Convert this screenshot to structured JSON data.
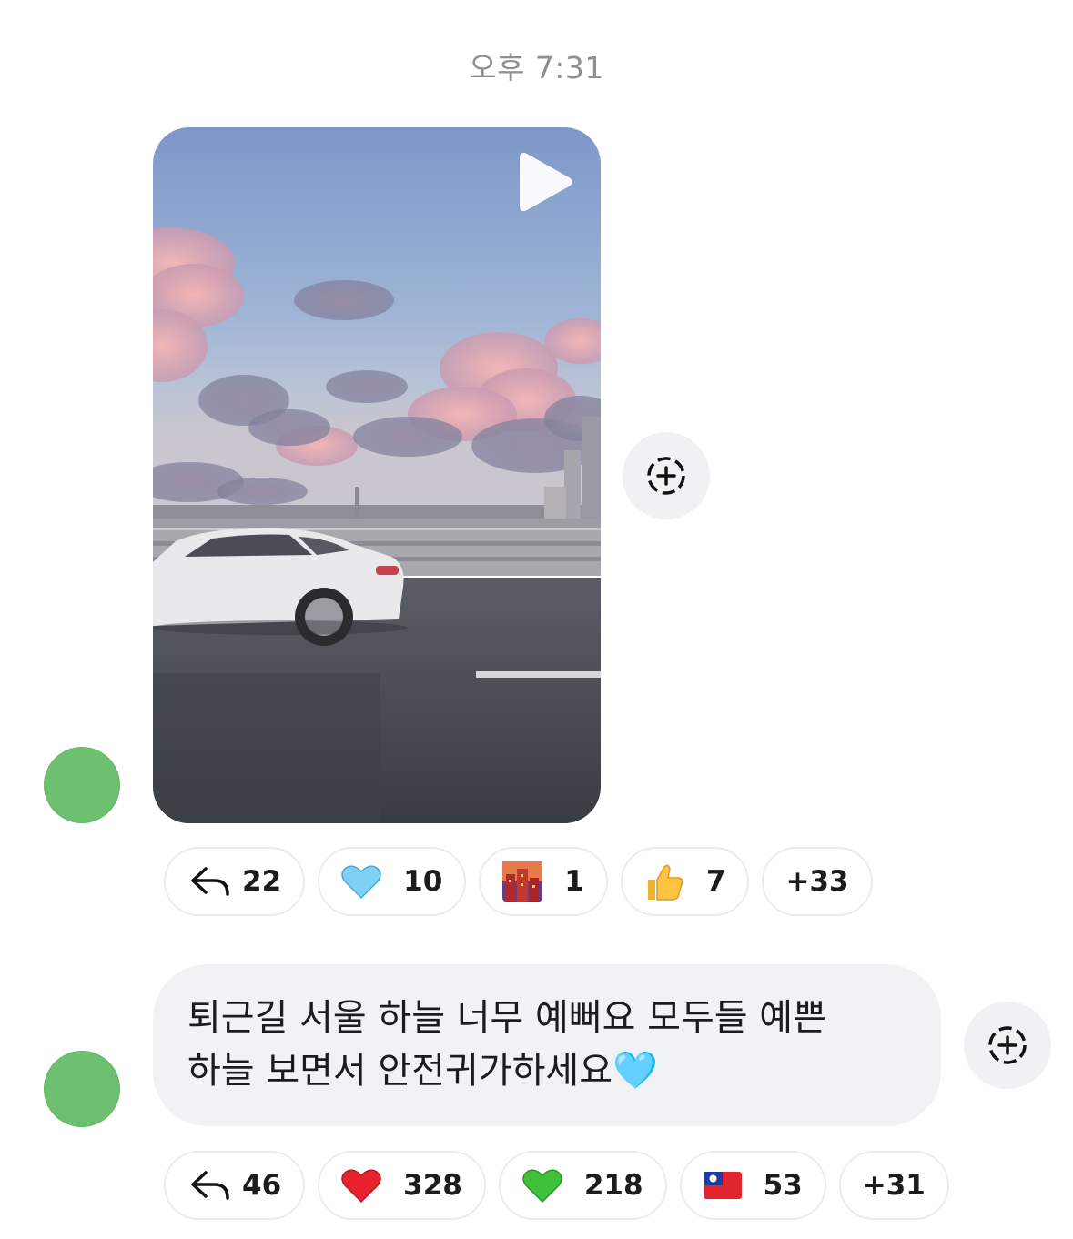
{
  "timestamp": "오후 7:31",
  "messages": [
    {
      "type": "video",
      "avatar_label": "",
      "reactions": [
        {
          "icon": "reply-arrow-icon",
          "emoji": "",
          "count": "22"
        },
        {
          "icon": "blue-heart-icon",
          "emoji": "🩵",
          "count": "10"
        },
        {
          "icon": "night-city-icon",
          "emoji": "🌆",
          "count": "1"
        },
        {
          "icon": "thumbs-up-icon",
          "emoji": "👍",
          "count": "7"
        },
        {
          "icon": "",
          "emoji": "",
          "count": "+33"
        }
      ]
    },
    {
      "type": "text",
      "lines": [
        "퇴근길 서울 하늘 너무 예뻐요 모두들 예쁜",
        "하늘 보면서 안전귀가하세요🩵"
      ],
      "reactions": [
        {
          "icon": "reply-arrow-icon",
          "emoji": "",
          "count": "46"
        },
        {
          "icon": "red-heart-icon",
          "emoji": "❤️",
          "count": "328"
        },
        {
          "icon": "green-heart-icon",
          "emoji": "💚",
          "count": "218"
        },
        {
          "icon": "taiwan-flag-icon",
          "emoji": "🇹🇼",
          "count": "53"
        },
        {
          "icon": "",
          "emoji": "",
          "count": "+31"
        }
      ]
    }
  ],
  "colors": {
    "bubble_bg": "#f1f2f4",
    "chip_border": "#ebecef",
    "avatar_bg": "#6cc070",
    "timestamp": "#8e8e93"
  }
}
